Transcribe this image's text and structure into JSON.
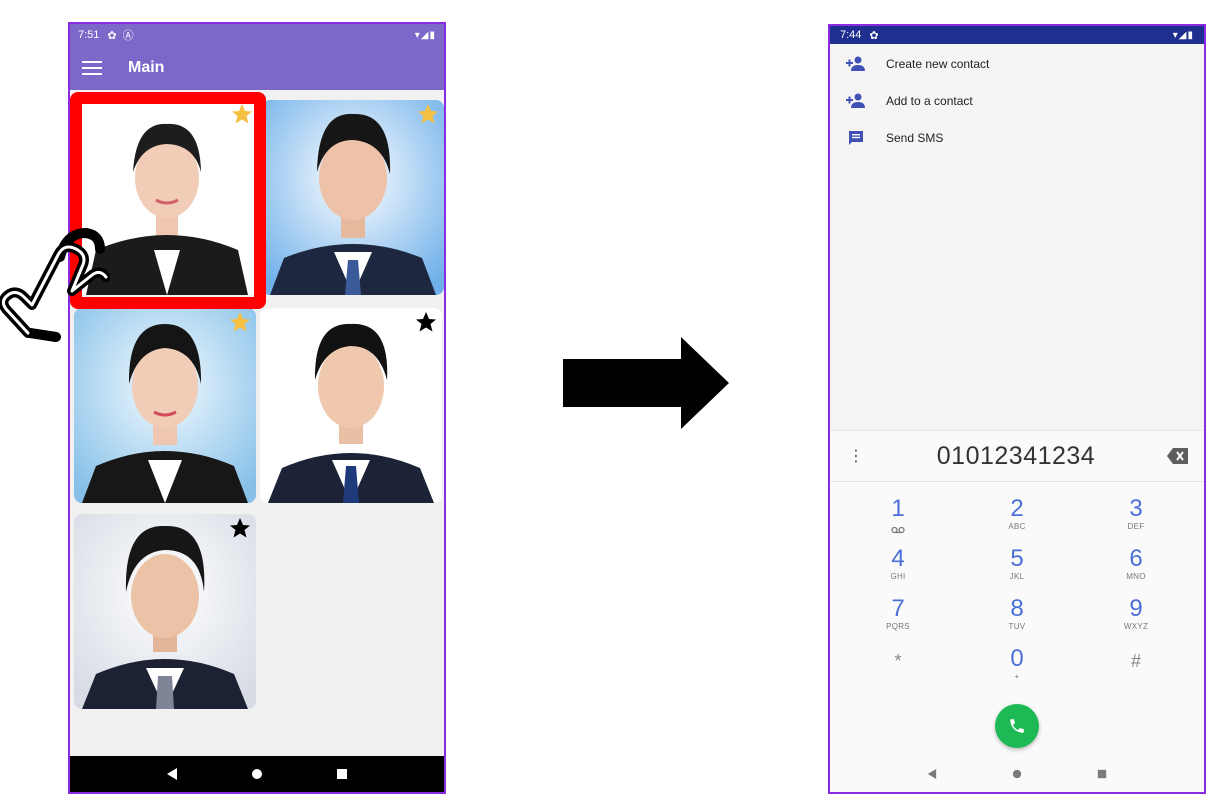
{
  "left_phone": {
    "status_bar": {
      "time": "7:51",
      "icons": [
        "gear-icon",
        "a-icon"
      ],
      "right_icons": [
        "wifi-icon",
        "signal-icon",
        "battery-icon"
      ]
    },
    "app_bar": {
      "title": "Main",
      "menu_icon": "hamburger-icon"
    },
    "contacts": [
      {
        "name": "contact-1",
        "background": "#ffffff",
        "favorite": true,
        "star_color": "#f6c142",
        "selected": true
      },
      {
        "name": "contact-2",
        "background": "#8fc3ee",
        "favorite": true,
        "star_color": "#f6c142",
        "selected": false
      },
      {
        "name": "contact-3",
        "background": "#9ccbea",
        "favorite": true,
        "star_color": "#f6c142",
        "selected": false
      },
      {
        "name": "contact-4",
        "background": "#ffffff",
        "favorite": false,
        "star_color": "#000000",
        "selected": false
      },
      {
        "name": "contact-5",
        "background": "#e5e8ee",
        "favorite": false,
        "star_color": "#000000",
        "selected": false
      }
    ],
    "nav": [
      "back-icon",
      "home-icon",
      "recents-icon"
    ],
    "colors": {
      "app_bar": "#7b68c8",
      "selection": "#ff0000"
    }
  },
  "right_phone": {
    "status_bar": {
      "time": "7:44",
      "icons": [
        "gear-icon"
      ],
      "right_icons": [
        "wifi-icon",
        "signal-icon",
        "battery-icon"
      ]
    },
    "menu": [
      {
        "label": "Create new contact",
        "icon": "add-person-icon"
      },
      {
        "label": "Add to a contact",
        "icon": "add-person-icon"
      },
      {
        "label": "Send SMS",
        "icon": "message-icon"
      }
    ],
    "dialer": {
      "number": "01012341234",
      "keys": [
        {
          "num": "1",
          "sub": "voicemail"
        },
        {
          "num": "2",
          "sub": "ABC"
        },
        {
          "num": "3",
          "sub": "DEF"
        },
        {
          "num": "4",
          "sub": "GHI"
        },
        {
          "num": "5",
          "sub": "JKL"
        },
        {
          "num": "6",
          "sub": "MNO"
        },
        {
          "num": "7",
          "sub": "PQRS"
        },
        {
          "num": "8",
          "sub": "TUV"
        },
        {
          "num": "9",
          "sub": "WXYZ"
        },
        {
          "num": "*",
          "sub": ""
        },
        {
          "num": "0",
          "sub": "+"
        },
        {
          "num": "#",
          "sub": ""
        }
      ],
      "call_button_color": "#1db954"
    },
    "nav": [
      "back-icon",
      "home-icon",
      "recents-icon"
    ],
    "colors": {
      "status_bar": "#1e2f8f",
      "accent": "#3f51b5"
    }
  }
}
